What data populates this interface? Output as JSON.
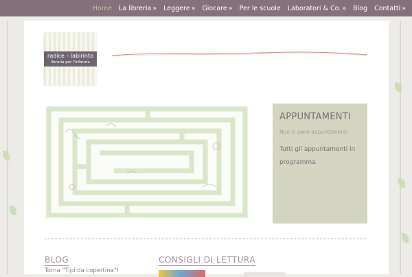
{
  "nav": {
    "items": [
      {
        "label": "Home",
        "active": true,
        "submenu": false
      },
      {
        "label": "La libreria",
        "active": false,
        "submenu": true
      },
      {
        "label": "Leggere",
        "active": false,
        "submenu": true
      },
      {
        "label": "Giocare",
        "active": false,
        "submenu": true
      },
      {
        "label": "Per le scuole",
        "active": false,
        "submenu": false
      },
      {
        "label": "Laboratori & Co.",
        "active": false,
        "submenu": true
      },
      {
        "label": "Blog",
        "active": false,
        "submenu": false
      },
      {
        "label": "Contatti",
        "active": false,
        "submenu": true
      }
    ],
    "submenu_arrow": "»"
  },
  "logo": {
    "name": "radice – labirinto",
    "subtitle": "libreria per l'infanzia"
  },
  "appointments": {
    "title": "APPUNTAMENTI",
    "empty_text": "Non ci sono appuntamenti",
    "all_link": "Tutti gli appuntamenti in programma"
  },
  "sections": {
    "blog": {
      "title": "BLOG",
      "first_post": "Torna \"Tipi da copertina\"!"
    },
    "reading": {
      "title": "CONSIGLI DI LETTURA"
    }
  },
  "colors": {
    "nav_bg": "#86707c",
    "nav_active": "#b6cf8b",
    "accent_mauve": "#a890a0",
    "appointments_bg": "#d3d5c0",
    "wave_line": "#d98a84"
  }
}
